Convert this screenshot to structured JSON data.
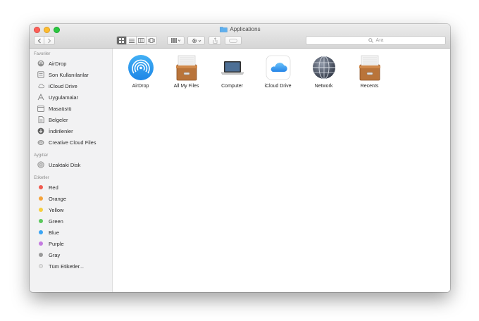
{
  "window": {
    "title": "Applications"
  },
  "toolbar": {
    "back_icon": "chevron-left",
    "forward_icon": "chevron-right",
    "views": [
      "icon-view",
      "list-view",
      "column-view",
      "cover-flow-view"
    ],
    "arrange_icon": "grid-arrange",
    "action_icon": "gear",
    "share_icon": "share",
    "tag_icon": "tag",
    "search_placeholder": "Ara"
  },
  "sidebar": {
    "favorites_heading": "Favoriler",
    "favorites": [
      {
        "label": "AirDrop",
        "icon": "airdrop-icon"
      },
      {
        "label": "Son Kullanılanlar",
        "icon": "recents-icon"
      },
      {
        "label": "iCloud Drive",
        "icon": "cloud-icon"
      },
      {
        "label": "Uygulamalar",
        "icon": "applications-icon"
      },
      {
        "label": "Masaüstü",
        "icon": "desktop-icon"
      },
      {
        "label": "Belgeler",
        "icon": "documents-icon"
      },
      {
        "label": "İndirilenler",
        "icon": "downloads-icon"
      },
      {
        "label": "Creative Cloud Files",
        "icon": "creative-cloud-icon"
      }
    ],
    "devices_heading": "Aygıtlar",
    "devices": [
      {
        "label": "Uzaktaki Disk",
        "icon": "disc-icon"
      }
    ],
    "tags_heading": "Etiketler",
    "tags": [
      {
        "label": "Red",
        "color": "#f05a4f"
      },
      {
        "label": "Orange",
        "color": "#f5a33a"
      },
      {
        "label": "Yellow",
        "color": "#f6cf3e"
      },
      {
        "label": "Green",
        "color": "#5bc85c"
      },
      {
        "label": "Blue",
        "color": "#3ba5f4"
      },
      {
        "label": "Purple",
        "color": "#c47be0"
      },
      {
        "label": "Gray",
        "color": "#9a9a9a"
      },
      {
        "label": "Tüm Etiketler...",
        "color": "#e4e4e4"
      }
    ]
  },
  "items": [
    {
      "label": "AirDrop",
      "icon": "airdrop"
    },
    {
      "label": "All My Files",
      "icon": "file-cabinet"
    },
    {
      "label": "Computer",
      "icon": "laptop"
    },
    {
      "label": "iCloud Drive",
      "icon": "icloud"
    },
    {
      "label": "Network",
      "icon": "globe"
    },
    {
      "label": "Recents",
      "icon": "file-cabinet"
    }
  ]
}
